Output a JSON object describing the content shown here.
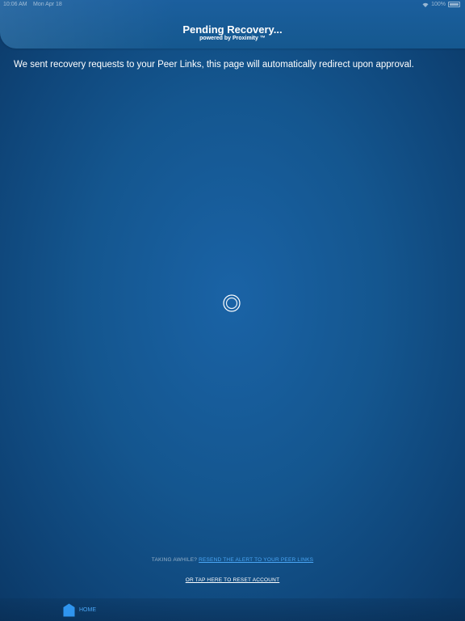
{
  "status_bar": {
    "time": "10:06 AM",
    "date": "Mon Apr 18",
    "battery": "100%"
  },
  "header": {
    "title": "Pending Recovery...",
    "subtitle": "powered by Proximity ™"
  },
  "main": {
    "message": "We sent recovery requests to your Peer Links,  this page will automatically redirect upon approval."
  },
  "footer": {
    "taking_awhile": "TAKING AWHILE?",
    "resend_link": "RESEND THE ALERT TO YOUR PEER LINKS",
    "reset_link": "OR TAP HERE TO RESET ACCOUNT"
  },
  "bottom_nav": {
    "home_label": "HOME",
    "home_icon": "home-icon"
  },
  "colors": {
    "background": "#14568f",
    "link": "#4aa6f5",
    "text": "#ffffff"
  }
}
